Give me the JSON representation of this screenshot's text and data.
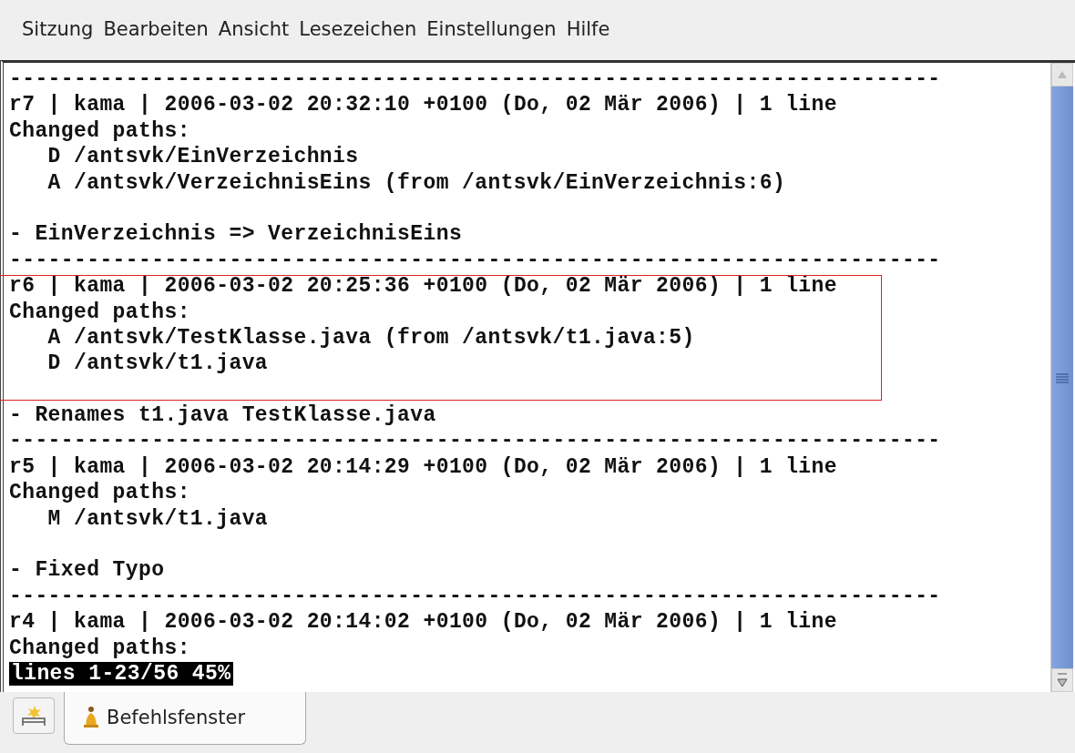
{
  "menu": [
    "Sitzung",
    "Bearbeiten",
    "Ansicht",
    "Lesezeichen",
    "Einstellungen",
    "Hilfe"
  ],
  "terminal": {
    "lines": [
      {
        "kind": "text",
        "text": "------------------------------------------------------------------------"
      },
      {
        "kind": "text",
        "text": "r7 | kama | 2006-03-02 20:32:10 +0100 (Do, 02 Mär 2006) | 1 line"
      },
      {
        "kind": "text",
        "text": "Changed paths:"
      },
      {
        "kind": "path",
        "text": "D /antsvk/EinVerzeichnis"
      },
      {
        "kind": "path",
        "text": "A /antsvk/VerzeichnisEins (from /antsvk/EinVerzeichnis:6)"
      },
      {
        "kind": "blank"
      },
      {
        "kind": "text",
        "text": "- EinVerzeichnis => VerzeichnisEins"
      },
      {
        "kind": "text",
        "text": "------------------------------------------------------------------------"
      },
      {
        "kind": "text",
        "text": "r6 | kama | 2006-03-02 20:25:36 +0100 (Do, 02 Mär 2006) | 1 line"
      },
      {
        "kind": "text",
        "text": "Changed paths:"
      },
      {
        "kind": "path",
        "text": "A /antsvk/TestKlasse.java (from /antsvk/t1.java:5)"
      },
      {
        "kind": "path",
        "text": "D /antsvk/t1.java"
      },
      {
        "kind": "blank"
      },
      {
        "kind": "text",
        "text": "- Renames t1.java TestKlasse.java"
      },
      {
        "kind": "text",
        "text": "------------------------------------------------------------------------"
      },
      {
        "kind": "text",
        "text": "r5 | kama | 2006-03-02 20:14:29 +0100 (Do, 02 Mär 2006) | 1 line"
      },
      {
        "kind": "text",
        "text": "Changed paths:"
      },
      {
        "kind": "path",
        "text": "M /antsvk/t1.java"
      },
      {
        "kind": "blank"
      },
      {
        "kind": "text",
        "text": "- Fixed Typo"
      },
      {
        "kind": "text",
        "text": "------------------------------------------------------------------------"
      },
      {
        "kind": "text",
        "text": "r4 | kama | 2006-03-02 20:14:02 +0100 (Do, 02 Mär 2006) | 1 line"
      },
      {
        "kind": "text",
        "text": "Changed paths:"
      },
      {
        "kind": "status",
        "text": "lines 1-23/56 45%"
      }
    ]
  },
  "tabs": [
    {
      "label": "Befehlsfenster",
      "selected": true
    }
  ]
}
